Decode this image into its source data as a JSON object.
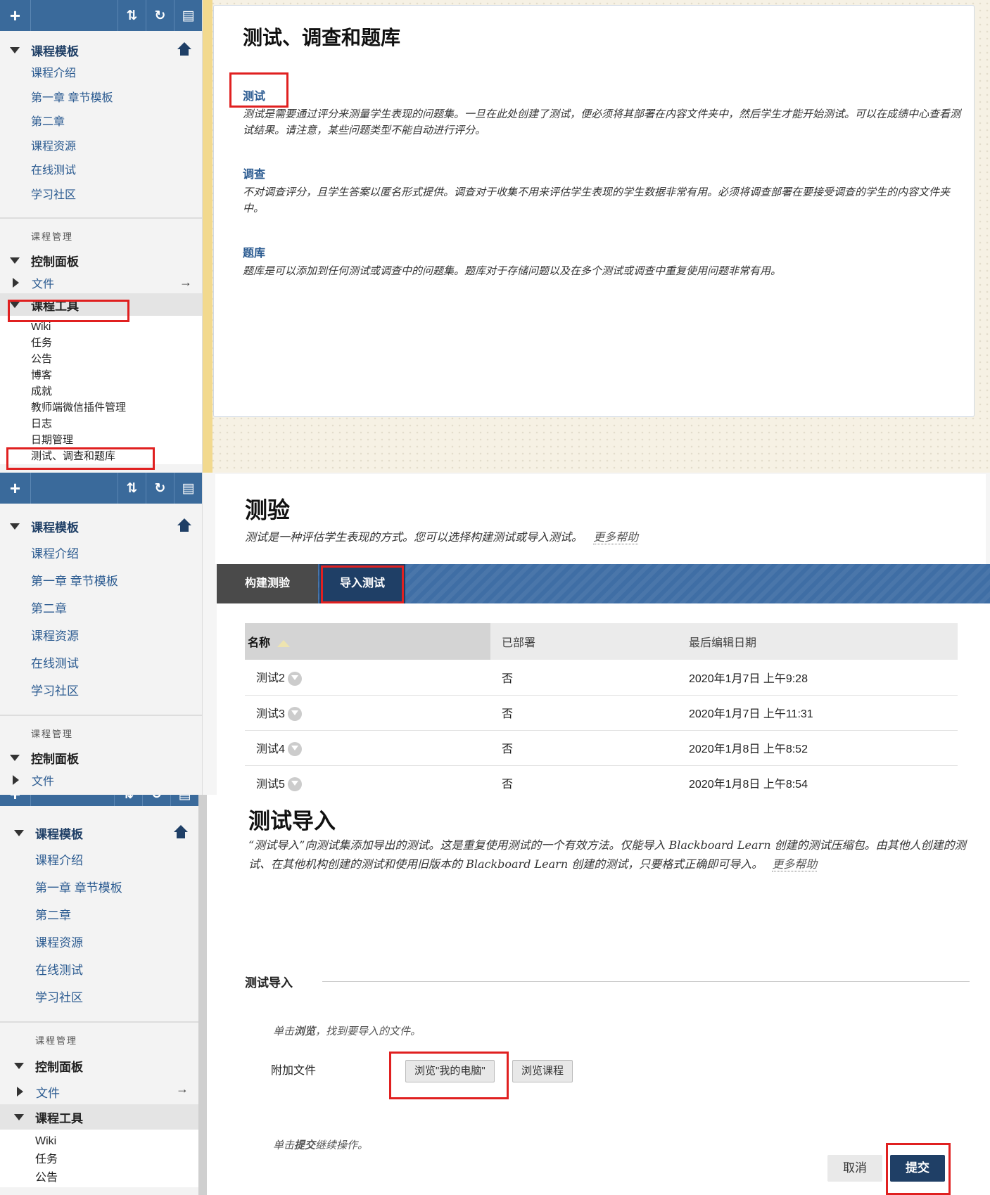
{
  "sidebar": {
    "toolbar": {
      "add": "+",
      "sort": "⇅",
      "refresh": "↻",
      "folder": "▤"
    },
    "course_section": "课程模板",
    "nav_items": [
      "课程介绍",
      "第一章 章节模板",
      "第二章",
      "课程资源",
      "在线测试",
      "学习社区"
    ],
    "mgmt_label": "课程管理",
    "control_panel": "控制面板",
    "files": "文件",
    "course_tools": "课程工具",
    "tool_items": [
      "Wiki",
      "任务",
      "公告",
      "博客",
      "成就",
      "教师端微信插件管理",
      "日志",
      "日期管理",
      "测试、调查和题库"
    ]
  },
  "panel1": {
    "title": "测试、调查和题库",
    "tests_heading": "测试",
    "tests_desc": "测试是需要通过评分来测量学生表现的问题集。一旦在此处创建了测试，便必须将其部署在内容文件夹中，然后学生才能开始测试。可以在成绩中心查看测试结果。请注意，某些问题类型不能自动进行评分。",
    "surveys_heading": "调查",
    "surveys_desc": "不对调查评分，且学生答案以匿名形式提供。调查对于收集不用来评估学生表现的学生数据非常有用。必须将调查部署在要接受调查的学生的内容文件夹中。",
    "pools_heading": "题库",
    "pools_desc": "题库是可以添加到任何测试或调查中的问题集。题库对于存储问题以及在多个测试或调查中重复使用问题非常有用。"
  },
  "panel2": {
    "title": "测验",
    "desc": "测试是一种评估学生表现的方式。您可以选择构建测试或导入测试。",
    "more_help": "更多帮助",
    "tab_build": "构建测验",
    "tab_import": "导入测试",
    "columns": [
      "名称",
      "已部署",
      "最后编辑日期"
    ],
    "rows": [
      {
        "name": "测试2",
        "deployed": "否",
        "date": "2020年1月7日 上午9:28"
      },
      {
        "name": "测试3",
        "deployed": "否",
        "date": "2020年1月7日 上午11:31"
      },
      {
        "name": "测试4",
        "deployed": "否",
        "date": "2020年1月8日 上午8:52"
      },
      {
        "name": "测试5",
        "deployed": "否",
        "date": "2020年1月8日 上午8:54"
      }
    ]
  },
  "panel3": {
    "title": "测试导入",
    "desc": "“测试导入”向测试集添加导出的测试。这是重复使用测试的一个有效方法。仅能导入 Blackboard Learn 创建的测试压缩包。由其他人创建的测试、在其他机构创建的测试和使用旧版本的 Blackboard Learn 创建的测试，只要格式正确即可导入。",
    "more_help": "更多帮助",
    "section_title": "测试导入",
    "browse_hint_pre": "单击",
    "browse_hint_bold": "浏览",
    "browse_hint_post": "，找到要导入的文件。",
    "attach_label": "附加文件",
    "browse_computer": "浏览\"我的电脑\"",
    "browse_course": "浏览课程",
    "submit_hint_pre": "单击",
    "submit_hint_bold": "提交",
    "submit_hint_post": "继续操作。",
    "cancel": "取消",
    "submit": "提交"
  },
  "colors": {
    "nav_blue": "#2a5a90",
    "header_blue": "#3f6ea5",
    "highlight_red": "#e02020",
    "submit_navy": "#1f3f66"
  }
}
